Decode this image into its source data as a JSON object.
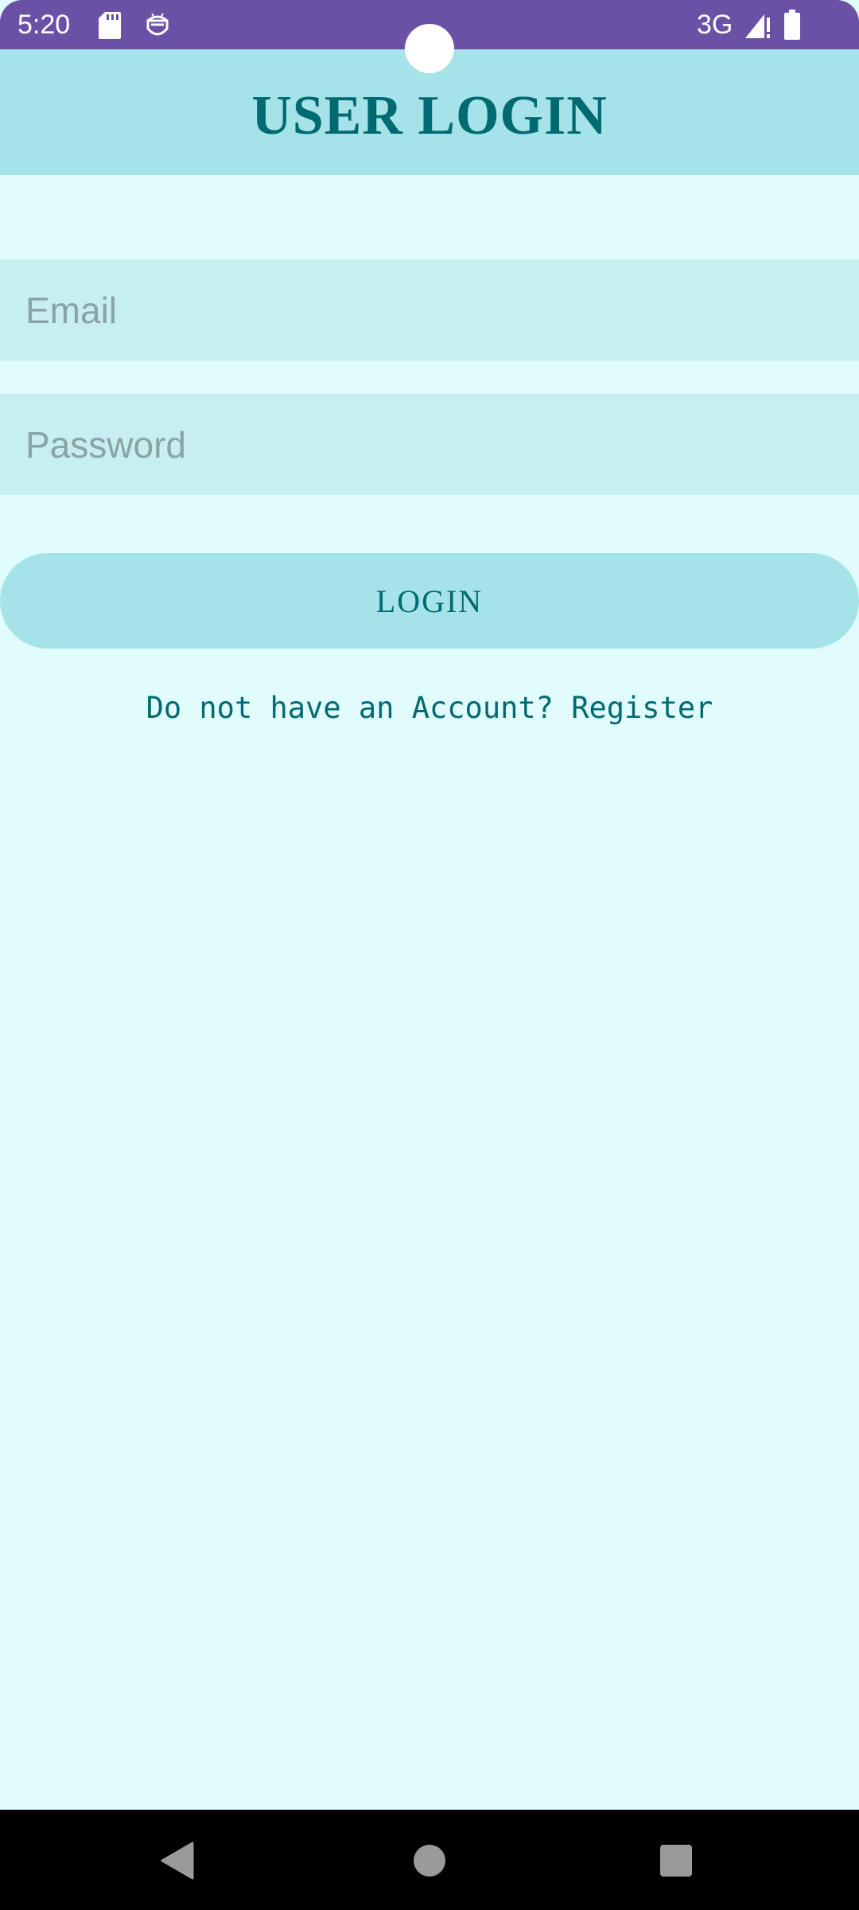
{
  "status_bar": {
    "time": "5:20",
    "network": "3G",
    "icons": [
      "sd-card-icon",
      "robot-icon",
      "signal-icon",
      "battery-icon"
    ],
    "background": "#6a51a6"
  },
  "header": {
    "title": "USER LOGIN",
    "background": "#a5e3e8",
    "text_color": "#006a72"
  },
  "form": {
    "email_placeholder": "Email",
    "password_placeholder": "Password",
    "email_value": "",
    "password_value": "",
    "login_label": "LOGIN",
    "register_text": "Do not have an Account? Register"
  },
  "nav_bar": {
    "icons": [
      "back-icon",
      "home-icon",
      "recents-icon"
    ]
  },
  "colors": {
    "page_background": "#e0fcfc",
    "field_background": "#c7eff1",
    "accent_text": "#006a72"
  }
}
